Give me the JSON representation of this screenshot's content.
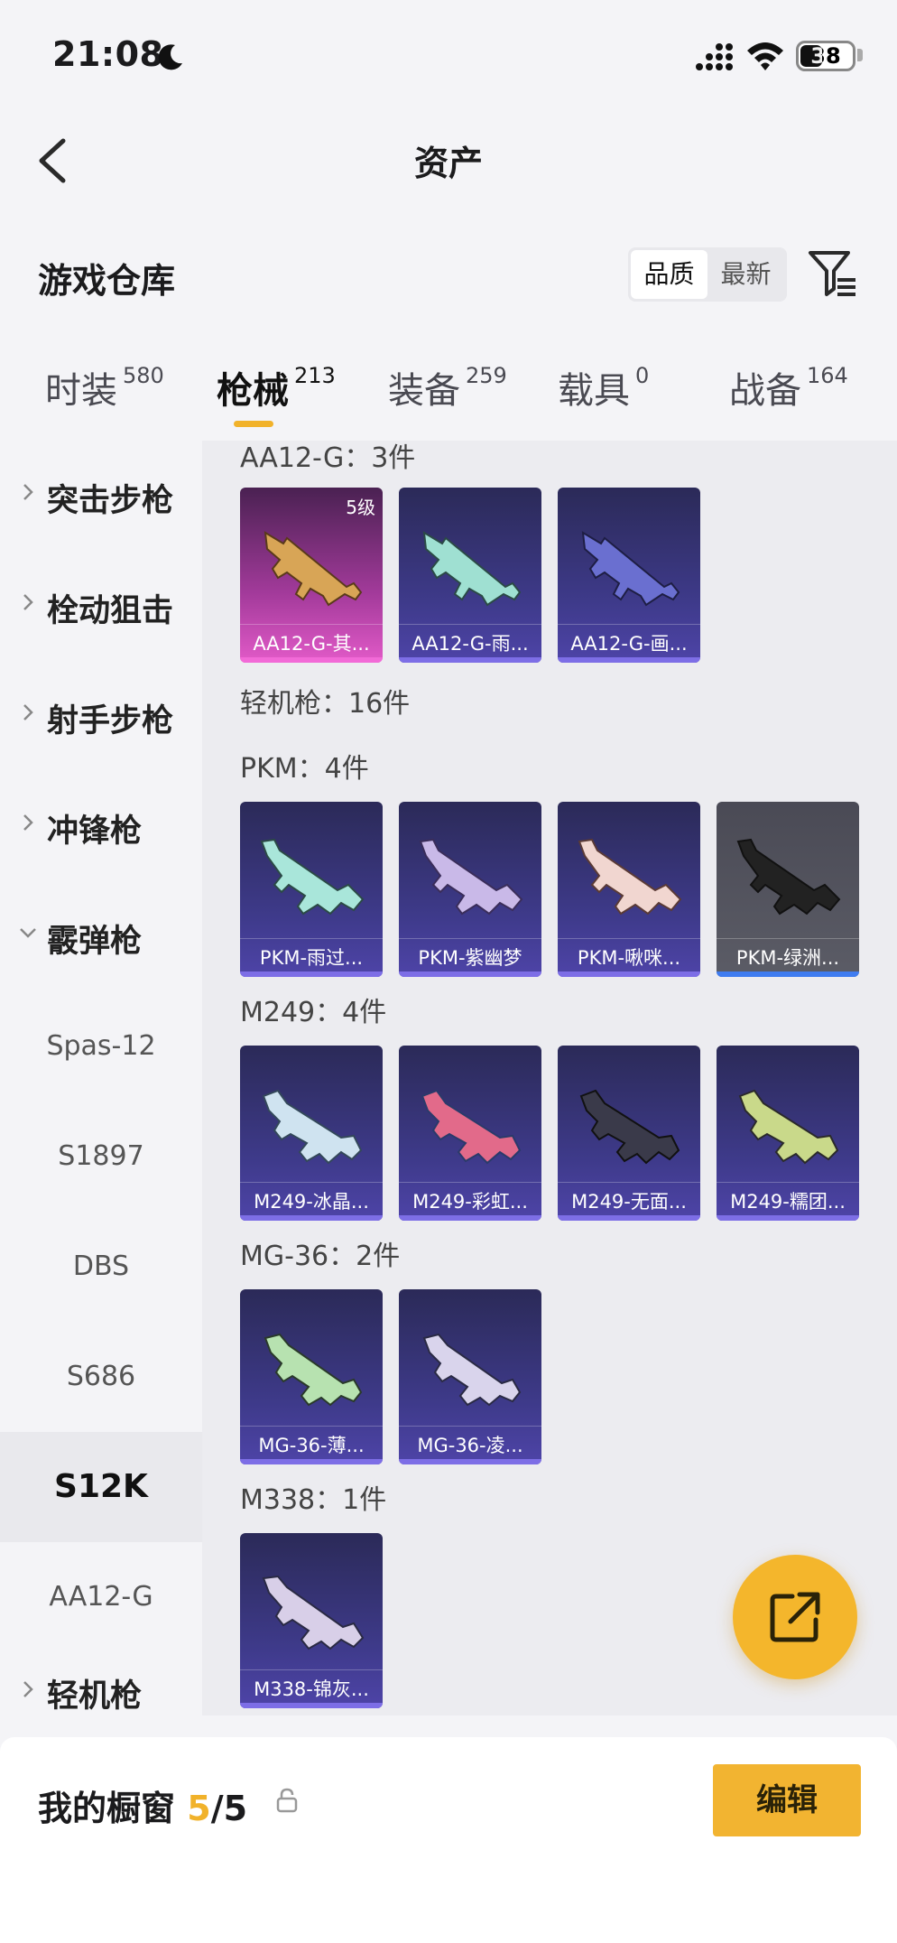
{
  "status_bar": {
    "time": "21:08",
    "battery": "38"
  },
  "header": {
    "title": "资产"
  },
  "warehouse": {
    "title": "游戏仓库",
    "sort_options": [
      "品质",
      "最新"
    ],
    "active_sort": 0
  },
  "tabs": [
    {
      "label": "时装",
      "count": "580"
    },
    {
      "label": "枪械",
      "count": "213"
    },
    {
      "label": "装备",
      "count": "259"
    },
    {
      "label": "载具",
      "count": "0"
    },
    {
      "label": "战备",
      "count": "164"
    }
  ],
  "sidebar": {
    "categories": [
      "突击步枪",
      "栓动狙击",
      "射手步枪",
      "冲锋枪",
      "霰弹枪"
    ],
    "shotgun_items": [
      "Spas-12",
      "S1897",
      "DBS",
      "S686",
      "S12K",
      "AA12-G"
    ],
    "active_item": "S12K",
    "next_category": "轻机枪"
  },
  "content": {
    "aa12": {
      "title": "AA12-G：3件",
      "cards": [
        "AA12-G-其...",
        "AA12-G-雨...",
        "AA12-G-画..."
      ],
      "first_level": "5级"
    },
    "lmg_total": "轻机枪：16件",
    "pkm": {
      "title": "PKM：4件",
      "cards": [
        "PKM-雨过...",
        "PKM-紫幽梦",
        "PKM-啾咪...",
        "PKM-绿洲..."
      ]
    },
    "m249": {
      "title": "M249：4件",
      "cards": [
        "M249-冰晶...",
        "M249-彩虹...",
        "M249-无面...",
        "M249-糯团..."
      ]
    },
    "mg36": {
      "title": "MG-36：2件",
      "cards": [
        "MG-36-薄...",
        "MG-36-凌..."
      ]
    },
    "m338": {
      "title": "M338：1件",
      "cards": [
        "M338-锦灰..."
      ]
    }
  },
  "showcase": {
    "title": "我的橱窗",
    "used": "5",
    "total": "/5"
  },
  "edit_button": "编辑",
  "colors": {
    "accent": "#f1b22a",
    "card_purple": "#3e3a8a",
    "card_pink": "#e25ac8"
  }
}
